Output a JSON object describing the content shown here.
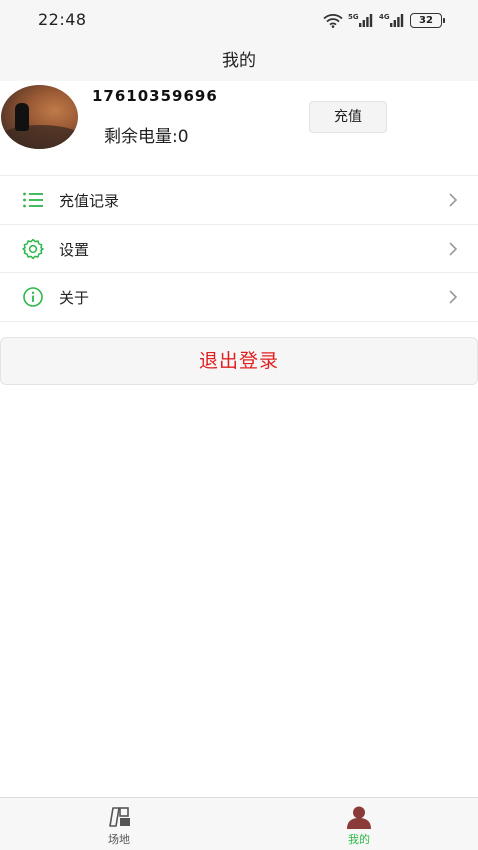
{
  "status_bar": {
    "time": "22:48",
    "network1": "5G",
    "network2": "4G",
    "battery": "32",
    "icons": [
      "wifi-icon",
      "signal-5g-icon",
      "signal-4g-icon",
      "battery-icon"
    ]
  },
  "header": {
    "title": "我的"
  },
  "profile": {
    "phone": "17610359696",
    "balance_label": "剩余电量:0",
    "recharge_button": "充值"
  },
  "menu": {
    "items": [
      {
        "label": "充值记录",
        "icon": "list-icon"
      },
      {
        "label": "设置",
        "icon": "gear-icon"
      },
      {
        "label": "关于",
        "icon": "info-icon"
      }
    ]
  },
  "logout_button": "退出登录",
  "tabbar": {
    "tabs": [
      {
        "label": "场地",
        "icon": "venue-icon",
        "active": false
      },
      {
        "label": "我的",
        "icon": "person-icon",
        "active": true
      }
    ]
  },
  "colors": {
    "accent_green": "#2db84a",
    "logout_red": "#e02020",
    "background_gray": "#f6f6f6"
  }
}
